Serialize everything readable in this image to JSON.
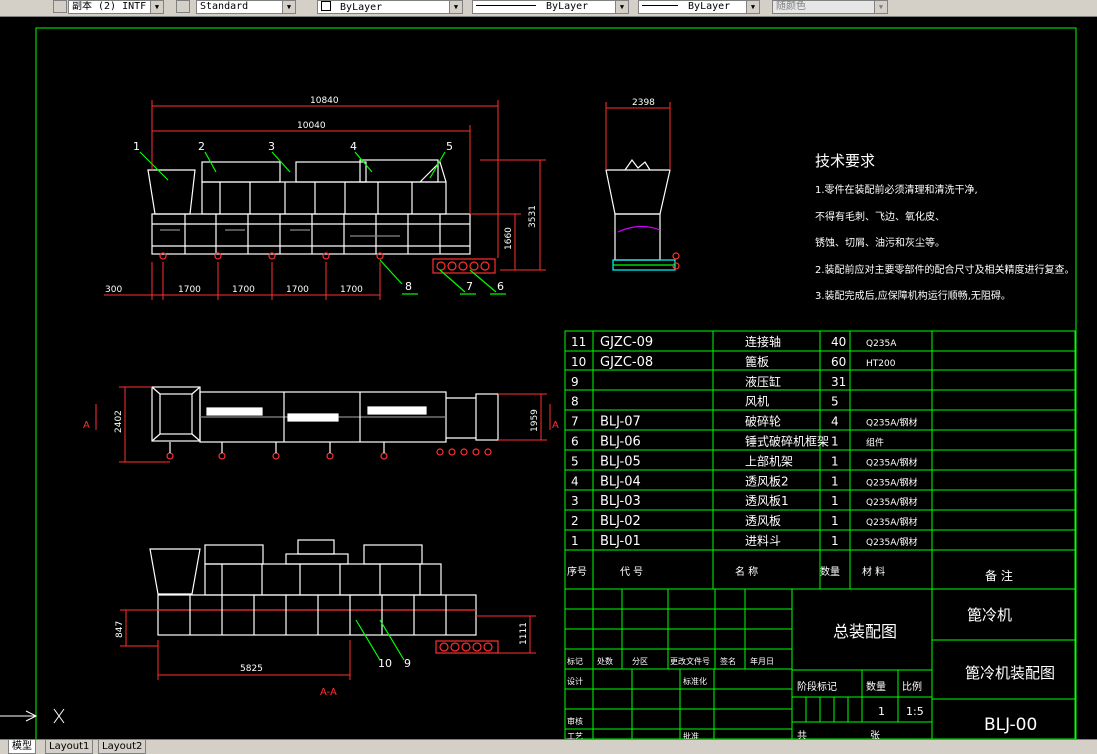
{
  "toolbar": {
    "text_style": "副本 (2) INTF",
    "dim_style": "Standard",
    "layer": "ByLayer",
    "linetype": "ByLayer",
    "lineweight": "ByLayer",
    "color": "随颜色"
  },
  "tabs": [
    {
      "label": "模型"
    },
    {
      "label": "Layout1"
    },
    {
      "label": "Layout2"
    }
  ],
  "drawing": {
    "dims": {
      "d10840": "10840",
      "d10040": "10040",
      "d2398": "2398",
      "d3531": "3531",
      "d1660": "1660",
      "d300": "300",
      "d1700a": "1700",
      "d1700b": "1700",
      "d1700c": "1700",
      "d1700d": "1700",
      "d2402": "2402",
      "d1959": "1959",
      "d847": "847",
      "d1111": "1111",
      "d5825": "5825"
    },
    "callouts": [
      "1",
      "2",
      "3",
      "4",
      "5",
      "6",
      "7",
      "8",
      "9",
      "10"
    ],
    "section_mark": "A",
    "section_label": "A-A",
    "tech": {
      "title": "技术要求",
      "line1": "1.零件在装配前必须清理和清洗干净,",
      "line2": "不得有毛刺、飞边、氧化皮、",
      "line3": "锈蚀、切屑、油污和灰尘等。",
      "line4": "2.装配前应对主要零部件的配合尺寸及相关精度进行复查。",
      "line5": "3.装配完成后,应保障机构运行顺畅,无阻碍。"
    },
    "bom": [
      {
        "no": "11",
        "code": "GJZC-09",
        "name": "连接轴",
        "qty": "40",
        "mat": "Q235A"
      },
      {
        "no": "10",
        "code": "GJZC-08",
        "name": "篦板",
        "qty": "60",
        "mat": "HT200"
      },
      {
        "no": "9",
        "code": "",
        "name": "液压缸",
        "qty": "31",
        "mat": ""
      },
      {
        "no": "8",
        "code": "",
        "name": "风机",
        "qty": "5",
        "mat": ""
      },
      {
        "no": "7",
        "code": "BLJ-07",
        "name": "破碎轮",
        "qty": "4",
        "mat": "Q235A/钢材"
      },
      {
        "no": "6",
        "code": "BLJ-06",
        "name": "锤式破碎机框架",
        "qty": "1",
        "mat": "组件"
      },
      {
        "no": "5",
        "code": "BLJ-05",
        "name": "上部机架",
        "qty": "1",
        "mat": "Q235A/钢材"
      },
      {
        "no": "4",
        "code": "BLJ-04",
        "name": "透风板2",
        "qty": "1",
        "mat": "Q235A/钢材"
      },
      {
        "no": "3",
        "code": "BLJ-03",
        "name": "透风板1",
        "qty": "1",
        "mat": "Q235A/钢材"
      },
      {
        "no": "2",
        "code": "BLJ-02",
        "name": "透风板",
        "qty": "1",
        "mat": "Q235A/钢材"
      },
      {
        "no": "1",
        "code": "BLJ-01",
        "name": "进料斗",
        "qty": "1",
        "mat": "Q235A/钢材"
      }
    ],
    "bom_header": {
      "no": "序号",
      "code": "代 号",
      "name": "名 称",
      "qty": "数量",
      "mat": "材 料",
      "note": "备 注"
    },
    "title_block": {
      "assembly": "总装配图",
      "machine": "篦冷机",
      "drawing_name": "篦冷机装配图",
      "drawing_no": "BLJ-00",
      "stage_label": "阶段标记",
      "qty_label": "数量",
      "scale_label": "比例",
      "qty_value": "1",
      "scale_value": "1:5",
      "mark": "标记",
      "count": "处数",
      "zone": "分区",
      "change_doc": "更改文件号",
      "sign": "签名",
      "date": "年月日",
      "design": "设计",
      "standard": "标准化",
      "review": "审核",
      "craft": "工艺",
      "approve": "批准",
      "total": "共",
      "sheet": "张"
    }
  }
}
